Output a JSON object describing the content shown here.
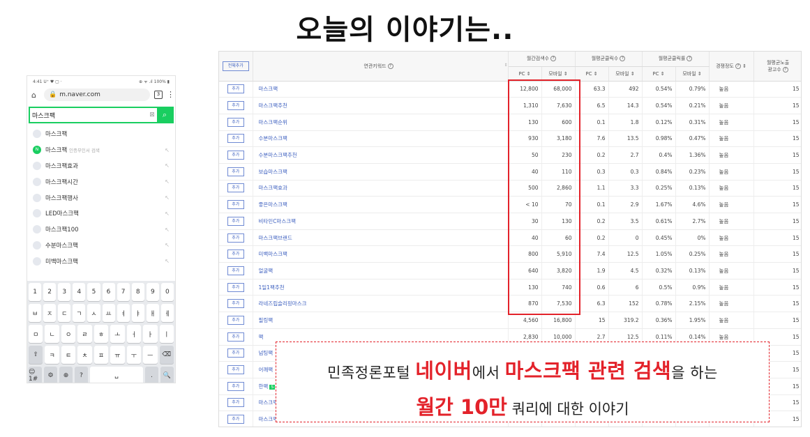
{
  "headline": "오늘의 이야기는..",
  "phone": {
    "status_left": "4:41 U⁺ ♥ ▢ ·",
    "status_right": "⊕ ᯤ .ıl 100% ▮",
    "url": "m.naver.com",
    "tab_count": "3",
    "search_value": "마스크팩",
    "suggestions": [
      {
        "text": "마스크팩",
        "sub": "",
        "green": false
      },
      {
        "text": "마스크팩",
        "sub": "인증무인서 검색",
        "green": true
      },
      {
        "text": "마스크팩효과",
        "sub": "",
        "green": false
      },
      {
        "text": "마스크팩시간",
        "sub": "",
        "green": false
      },
      {
        "text": "마스크팩행사",
        "sub": "",
        "green": false
      },
      {
        "text": "LED마스크팩",
        "sub": "",
        "green": false
      },
      {
        "text": "마스크팩100",
        "sub": "",
        "green": false
      },
      {
        "text": "수분마스크팩",
        "sub": "",
        "green": false
      },
      {
        "text": "미백마스크팩",
        "sub": "",
        "green": false
      }
    ],
    "keyboard": [
      [
        "1",
        "2",
        "3",
        "4",
        "5",
        "6",
        "7",
        "8",
        "9",
        "0"
      ],
      [
        "ㅂ",
        "ㅈ",
        "ㄷ",
        "ㄱ",
        "ㅅ",
        "ㅛ",
        "ㅕ",
        "ㅑ",
        "ㅐ",
        "ㅔ"
      ],
      [
        "ㅁ",
        "ㄴ",
        "ㅇ",
        "ㄹ",
        "ㅎ",
        "ㅗ",
        "ㅓ",
        "ㅏ",
        "ㅣ"
      ],
      [
        "⇧",
        "ㅋ",
        "ㅌ",
        "ㅊ",
        "ㅍ",
        "ㅠ",
        "ㅜ",
        "ㅡ",
        "⌫"
      ],
      [
        "☺1#",
        "⚙",
        "⊕",
        "?",
        "␣",
        ".",
        "🔍"
      ]
    ]
  },
  "table": {
    "all_add_label": "전체추가",
    "col_keyword": "연관키워드",
    "col_monthly_search": "월간검색수",
    "col_avg_clicks": "월평균클릭수",
    "col_avg_ctr": "월평균클릭률",
    "col_competition": "경쟁정도",
    "col_avg_ads_1": "월평균노출",
    "col_avg_ads_2": "광고수",
    "sub_pc": "PC",
    "sub_mobile": "모바일",
    "add_label": "추가",
    "rows": [
      {
        "kw": "마스크팩",
        "pc": "12,800",
        "mo": "68,000",
        "cpc": "63.3",
        "cmo": "492",
        "rpc": "0.54%",
        "rmo": "0.79%",
        "comp": "높음",
        "ads": "15"
      },
      {
        "kw": "마스크팩추천",
        "pc": "1,310",
        "mo": "7,630",
        "cpc": "6.5",
        "cmo": "14.3",
        "rpc": "0.54%",
        "rmo": "0.21%",
        "comp": "높음",
        "ads": "15"
      },
      {
        "kw": "마스크팩순위",
        "pc": "130",
        "mo": "600",
        "cpc": "0.1",
        "cmo": "1.8",
        "rpc": "0.12%",
        "rmo": "0.31%",
        "comp": "높음",
        "ads": "15"
      },
      {
        "kw": "수분마스크팩",
        "pc": "930",
        "mo": "3,180",
        "cpc": "7.6",
        "cmo": "13.5",
        "rpc": "0.98%",
        "rmo": "0.47%",
        "comp": "높음",
        "ads": "15"
      },
      {
        "kw": "수분마스크팩추천",
        "pc": "50",
        "mo": "230",
        "cpc": "0.2",
        "cmo": "2.7",
        "rpc": "0.4%",
        "rmo": "1.36%",
        "comp": "높음",
        "ads": "15"
      },
      {
        "kw": "보습마스크팩",
        "pc": "40",
        "mo": "110",
        "cpc": "0.3",
        "cmo": "0.3",
        "rpc": "0.84%",
        "rmo": "0.23%",
        "comp": "높음",
        "ads": "15"
      },
      {
        "kw": "마스크팩효과",
        "pc": "500",
        "mo": "2,860",
        "cpc": "1.1",
        "cmo": "3.3",
        "rpc": "0.25%",
        "rmo": "0.13%",
        "comp": "높음",
        "ads": "15"
      },
      {
        "kw": "좋은마스크팩",
        "pc": "< 10",
        "mo": "70",
        "cpc": "0.1",
        "cmo": "2.9",
        "rpc": "1.67%",
        "rmo": "4.6%",
        "comp": "높음",
        "ads": "15"
      },
      {
        "kw": "비타민C마스크팩",
        "pc": "30",
        "mo": "130",
        "cpc": "0.2",
        "cmo": "3.5",
        "rpc": "0.61%",
        "rmo": "2.7%",
        "comp": "높음",
        "ads": "15"
      },
      {
        "kw": "마스크팩브랜드",
        "pc": "40",
        "mo": "60",
        "cpc": "0.2",
        "cmo": "0",
        "rpc": "0.45%",
        "rmo": "0%",
        "comp": "높음",
        "ads": "15"
      },
      {
        "kw": "미백마스크팩",
        "pc": "800",
        "mo": "5,910",
        "cpc": "7.4",
        "cmo": "12.5",
        "rpc": "1.05%",
        "rmo": "0.25%",
        "comp": "높음",
        "ads": "15"
      },
      {
        "kw": "얼굴팩",
        "pc": "640",
        "mo": "3,820",
        "cpc": "1.9",
        "cmo": "4.5",
        "rpc": "0.32%",
        "rmo": "0.13%",
        "comp": "높음",
        "ads": "15"
      },
      {
        "kw": "1일1팩추천",
        "pc": "130",
        "mo": "740",
        "cpc": "0.6",
        "cmo": "6",
        "rpc": "0.5%",
        "rmo": "0.9%",
        "comp": "높음",
        "ads": "15"
      },
      {
        "kw": "라네즈립슬리핑마스크",
        "pc": "870",
        "mo": "7,530",
        "cpc": "6.3",
        "cmo": "152",
        "rpc": "0.78%",
        "rmo": "2.15%",
        "comp": "높음",
        "ads": "15"
      },
      {
        "kw": "필링팩",
        "pc": "4,560",
        "mo": "16,800",
        "cpc": "15",
        "cmo": "319.2",
        "rpc": "0.36%",
        "rmo": "1.95%",
        "comp": "높음",
        "ads": "15"
      },
      {
        "kw": "팩",
        "pc": "2,830",
        "mo": "10,000",
        "cpc": "2.7",
        "cmo": "12.5",
        "rpc": "0.11%",
        "rmo": "0.14%",
        "comp": "높음",
        "ads": "15"
      },
      {
        "kw": "넘팅팩",
        "pc": "",
        "mo": "",
        "cpc": "",
        "cmo": "",
        "rpc": "",
        "rmo": "",
        "comp": "",
        "ads": "15"
      },
      {
        "kw": "어깨팩",
        "pc": "",
        "mo": "",
        "cpc": "",
        "cmo": "",
        "rpc": "",
        "rmo": "",
        "comp": "",
        "ads": "15"
      },
      {
        "kw": "한팩",
        "pc": "",
        "mo": "",
        "cpc": "",
        "cmo": "",
        "rpc": "",
        "rmo": "",
        "comp": "",
        "ads": "15",
        "badge": "S"
      },
      {
        "kw": "마스크팩",
        "pc": "",
        "mo": "",
        "cpc": "",
        "cmo": "",
        "rpc": "",
        "rmo": "",
        "comp": "",
        "ads": "15"
      },
      {
        "kw": "마스크팩",
        "pc": "",
        "mo": "",
        "cpc": "",
        "cmo": "",
        "rpc": "",
        "rmo": "",
        "comp": "",
        "ads": "15"
      }
    ]
  },
  "overlay": {
    "l1_a": "민족정론포털 ",
    "l1_b": "네이버",
    "l1_c": "에서 ",
    "l1_d": "마스크팩 관련 검색",
    "l1_e": "을 하는",
    "l2_a": "월간 10만",
    "l2_b": " 쿼리에 대한 이야기"
  },
  "colors": {
    "accent_red": "#e3222a",
    "naver_green": "#19ce60",
    "link_blue": "#3c5fbf"
  }
}
